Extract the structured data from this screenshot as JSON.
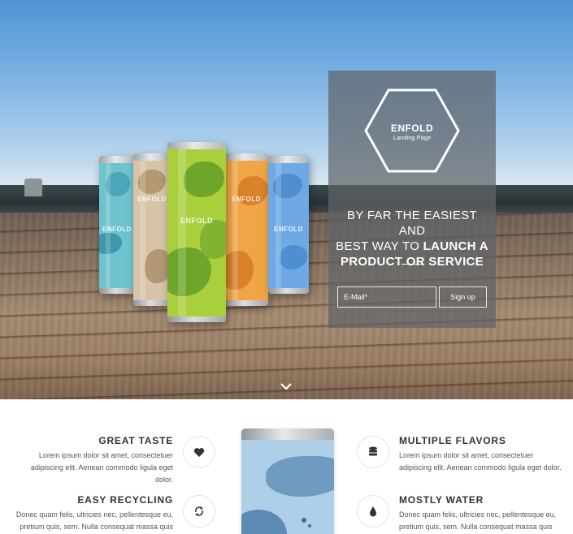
{
  "hero": {
    "logo": {
      "title": "ENFOLD",
      "subtitle": "Landing Page"
    },
    "headline": {
      "line1": "BY FAR THE EASIEST AND",
      "line2_plain": "BEST WAY TO ",
      "line2_bold": "LAUNCH A",
      "line3_bold": "PRODUCT OR SERVICE"
    },
    "email_placeholder": "E-Mail*",
    "signup_label": "Sign up",
    "can_brand": "ENFOLD"
  },
  "features": {
    "left": [
      {
        "title": "GREAT TASTE",
        "text": "Lorem ipsum dolor sit amet, consectetuer adipiscing elit. Aenean commodo ligula eget dolor.",
        "icon": "heart-icon"
      },
      {
        "title": "EASY RECYCLING",
        "text": "Donec quam felis, ultricies nec, pellentesque eu, pretium quis, sem. Nulla consequat massa quis",
        "icon": "recycle-icon"
      }
    ],
    "right": [
      {
        "title": "MULTIPLE FLAVORS",
        "text": "Lorem ipsum dolor sit amet, consectetuer adipiscing elit. Aenean commodo ligula eget dolor.",
        "icon": "database-icon"
      },
      {
        "title": "MOSTLY WATER",
        "text": "Donec quam felis, ultricies nec, pellentesque eu, pretium quis, sem. Nulla consequat massa quis",
        "icon": "drop-icon"
      }
    ]
  }
}
